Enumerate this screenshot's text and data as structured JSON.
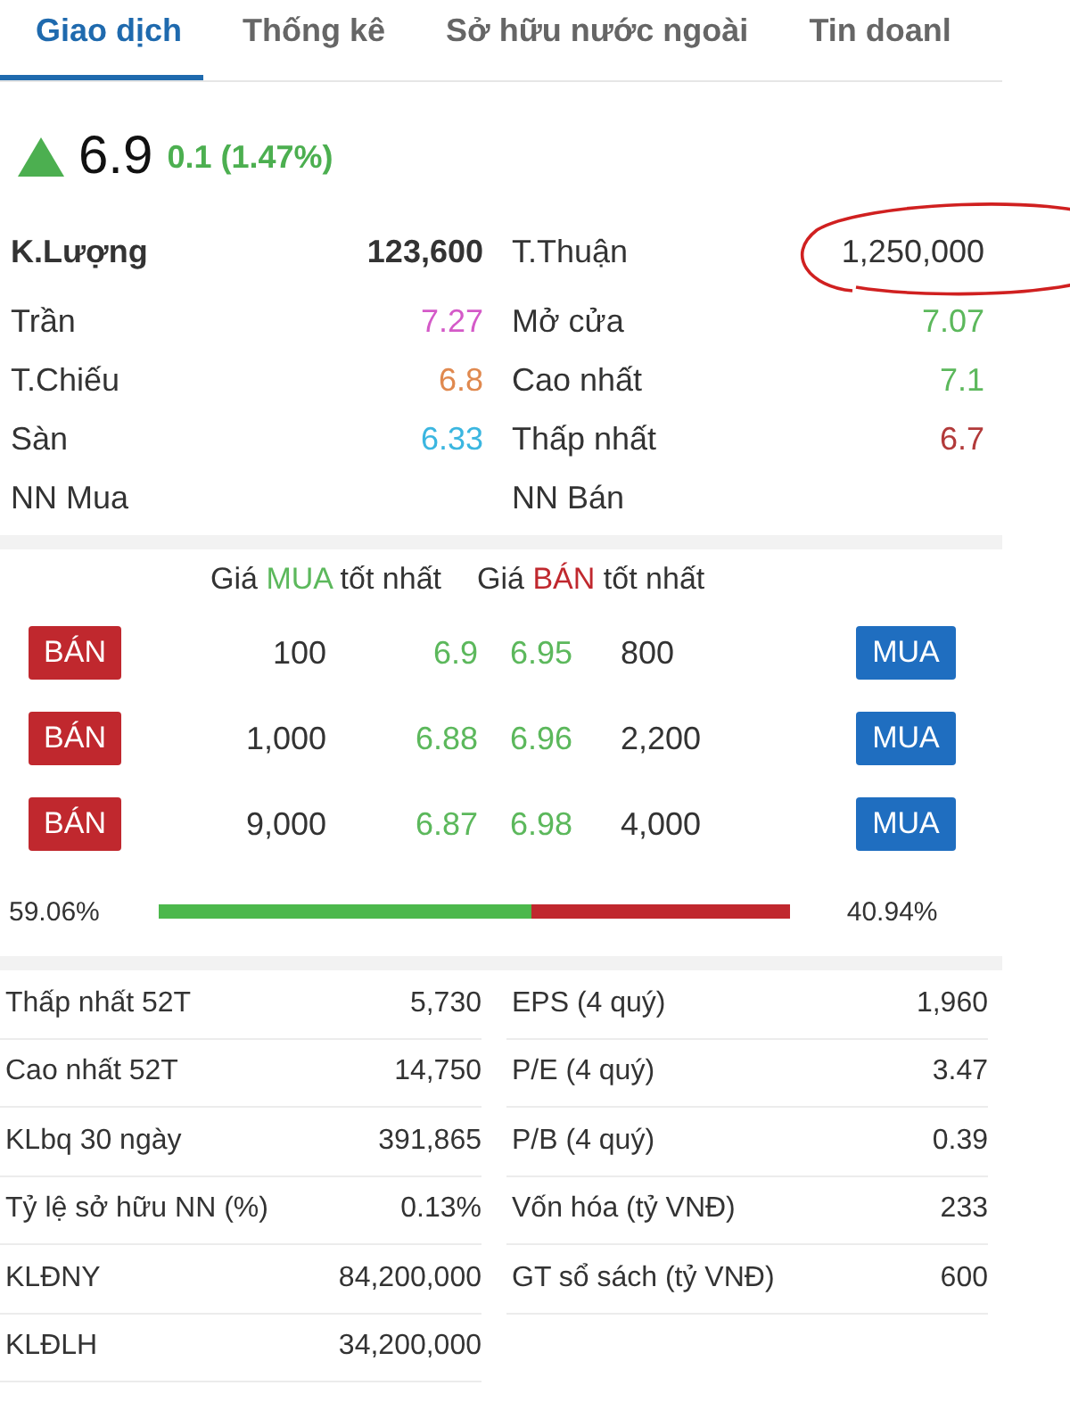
{
  "tabs": [
    {
      "label": "Giao dịch",
      "selected": true
    },
    {
      "label": "Thống kê",
      "selected": false
    },
    {
      "label": "Sở hữu nước ngoài",
      "selected": false
    },
    {
      "label": "Tin doanl",
      "selected": false
    }
  ],
  "quote": {
    "kind": "up",
    "price": "6.9",
    "change": "0.1 (1.47%)",
    "color": "#4caf50"
  },
  "stats": [
    {
      "kind": "header",
      "left": {
        "label": "K.Lượng",
        "value": "123,600",
        "color": "#333333"
      },
      "right": {
        "label": "T.Thuận",
        "value": "1,250,000",
        "color": "#333333",
        "circled": true
      }
    },
    {
      "kind": "plain",
      "left": {
        "label": "Trần",
        "value": "7.27",
        "color": "#d45ac8"
      },
      "right": {
        "label": "Mở cửa",
        "value": "7.07",
        "color": "#5cb85c"
      }
    },
    {
      "kind": "plain",
      "left": {
        "label": "T.Chiếu",
        "value": "6.8",
        "color": "#e0894f"
      },
      "right": {
        "label": "Cao nhất",
        "value": "7.1",
        "color": "#5cb85c"
      }
    },
    {
      "kind": "plain",
      "left": {
        "label": "Sàn",
        "value": "6.33",
        "color": "#3bb6e0"
      },
      "right": {
        "label": "Thấp nhất",
        "value": "6.7",
        "color": "#b23a3a"
      }
    },
    {
      "kind": "plain",
      "left": {
        "label": "NN Mua"
      },
      "right": {
        "label": "NN Bán"
      }
    }
  ],
  "order_book": {
    "bid_header": {
      "prefix": "Giá",
      "side": "MUA",
      "suffix": "tốt nhất",
      "color": "#5cb85c"
    },
    "ask_header": {
      "prefix": "Giá",
      "side": "BÁN",
      "suffix": "tốt nhất",
      "color": "#c0282e"
    },
    "rows": [
      {
        "sell_button": "BÁN",
        "bid_volume": "100",
        "bid_price": "6.9",
        "ask_price": "6.95",
        "ask_volume": "800",
        "buy_button": "MUA"
      },
      {
        "sell_button": "BÁN",
        "bid_volume": "1,000",
        "bid_price": "6.88",
        "ask_price": "6.96",
        "ask_volume": "2,200",
        "buy_button": "MUA"
      },
      {
        "sell_button": "BÁN",
        "bid_volume": "9,000",
        "bid_price": "6.87",
        "ask_price": "6.98",
        "ask_volume": "4,000",
        "buy_button": "MUA"
      }
    ],
    "balance": {
      "bid_percent": "59.06%",
      "ask_percent": "40.94%",
      "level": 0.5906
    }
  },
  "fundamentals": [
    {
      "left": {
        "label": "Thấp nhất 52T",
        "value": "5,730"
      },
      "right": {
        "label": "EPS (4 quý)",
        "value": "1,960"
      }
    },
    {
      "left": {
        "label": "Cao nhất 52T",
        "value": "14,750"
      },
      "right": {
        "label": "P/E (4 quý)",
        "value": "3.47"
      }
    },
    {
      "left": {
        "label": "KLbq 30 ngày",
        "value": "391,865"
      },
      "right": {
        "label": "P/B (4 quý)",
        "value": "0.39"
      }
    },
    {
      "left": {
        "label": "Tỷ lệ sở hữu NN (%)",
        "value": "0.13%"
      },
      "right": {
        "label": "Vốn hóa (tỷ VNĐ)",
        "value": "233"
      }
    },
    {
      "left": {
        "label": "KLĐNY",
        "value": "84,200,000"
      },
      "right": {
        "label": "GT sổ sách (tỷ VNĐ)",
        "value": "600"
      }
    },
    {
      "left": {
        "label": "KLĐLH",
        "value": "34,200,000"
      }
    }
  ]
}
